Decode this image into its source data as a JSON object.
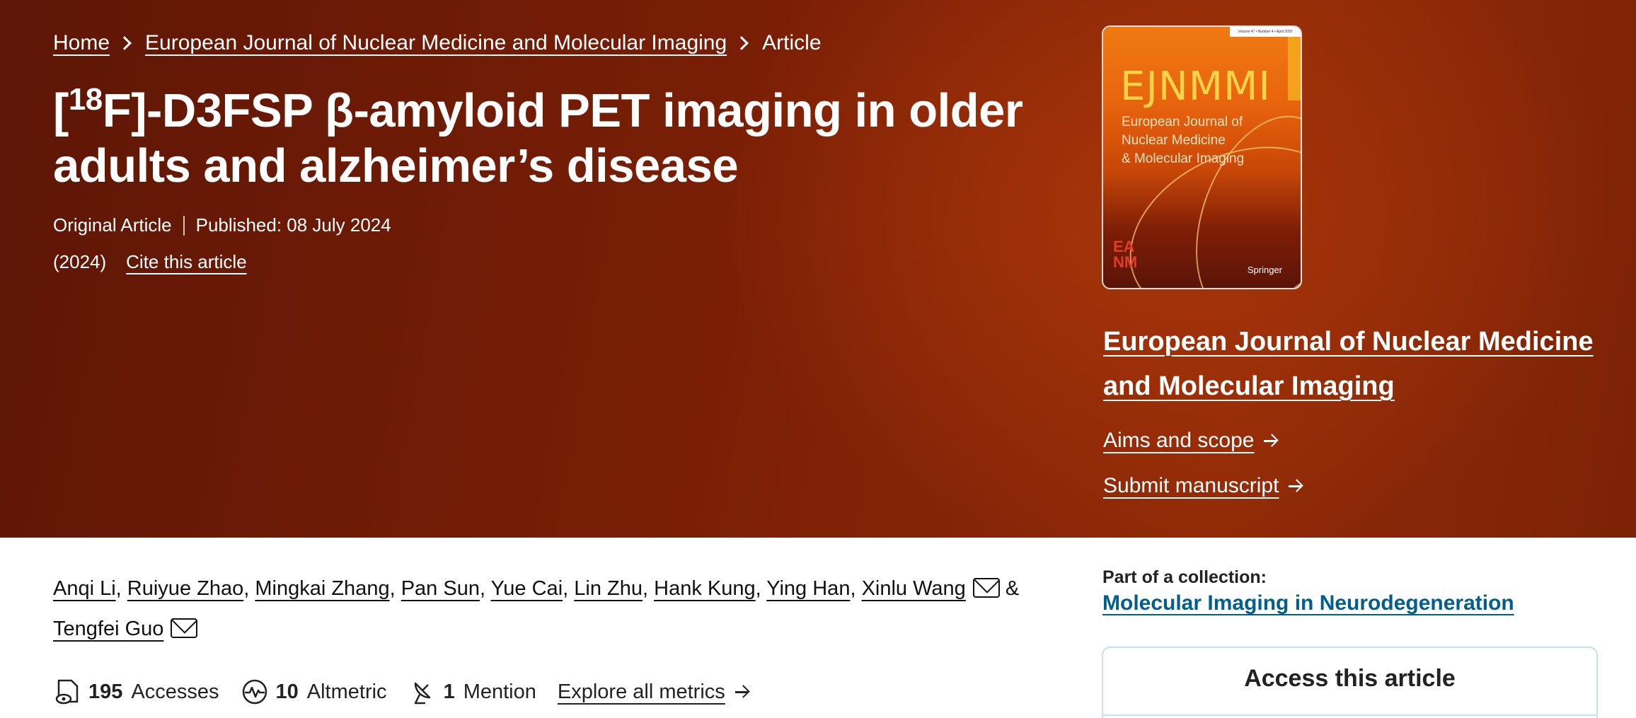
{
  "breadcrumb": {
    "home": "Home",
    "journal": "European Journal of Nuclear Medicine and Molecular Imaging",
    "current": "Article"
  },
  "article": {
    "title_prefix": "[",
    "title_sup": "18",
    "title_rest": "F]-D3FSP β-amyloid PET imaging in older adults and alzheimer’s disease",
    "type": "Original Article",
    "published": "Published: 08 July 2024",
    "year": "(2024)",
    "cite": "Cite this article"
  },
  "cover": {
    "issue_line": "Volume 47 • Number 4 • April 2020",
    "acronym": "EJNMMI",
    "subtitle_lines": [
      "European Journal of",
      "Nuclear Medicine",
      "& Molecular Imaging"
    ],
    "logo": "EANM",
    "publisher": "Springer"
  },
  "journal_sidebar": {
    "title": "European Journal of Nuclear Medicine and Molecular Imaging",
    "aims": "Aims and scope",
    "submit": "Submit manuscript"
  },
  "authors": {
    "names": [
      "Anqi Li",
      "Ruiyue Zhao",
      "Mingkai Zhang",
      "Pan Sun",
      "Yue Cai",
      "Lin Zhu",
      "Hank Kung",
      "Ying Han",
      "Xinlu Wang"
    ],
    "ampersand": "&",
    "last": "Tengfei Guo"
  },
  "metrics": {
    "accesses_value": "195",
    "accesses_label": "Accesses",
    "altmetric_value": "10",
    "altmetric_label": "Altmetric",
    "mention_value": "1",
    "mention_label": "Mention",
    "explore": "Explore all metrics"
  },
  "collection": {
    "label": "Part of a collection:",
    "name": "Molecular Imaging in Neurodegeneration"
  },
  "access": {
    "heading": "Access this article"
  },
  "colors": {
    "hero": "#7a1f06",
    "link_blue": "#025e8d",
    "box_border": "#c5e0f4"
  }
}
